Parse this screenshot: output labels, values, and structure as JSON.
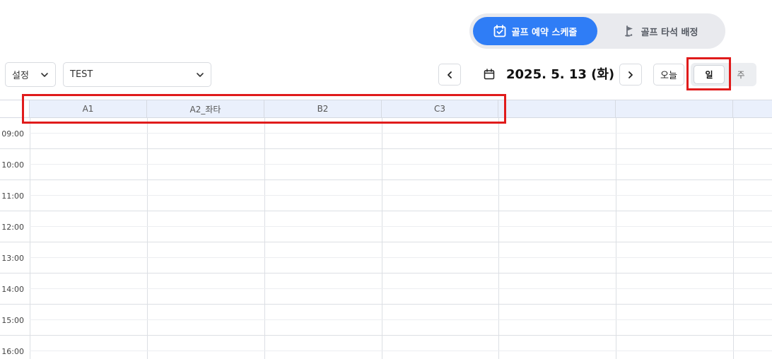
{
  "mode_toggle": {
    "active_label": "골프 예약 스케줄",
    "active_icon": "calendar-check-icon",
    "inactive_label": "골프 타석 배정",
    "inactive_icon": "golf-flag-icon",
    "accent_color": "#2f7df6"
  },
  "toolbar": {
    "settings_select": "설정",
    "store_select": "TEST",
    "date": "2025. 5. 13 (화)",
    "today_label": "오늘",
    "view_day_label": "일",
    "view_week_label": "주",
    "selected_view": "일"
  },
  "schedule": {
    "columns": [
      "A1",
      "A2_좌타",
      "B2",
      "C3",
      "",
      "",
      ""
    ],
    "times": [
      "09:00",
      "10:00",
      "11:00",
      "12:00",
      "13:00",
      "14:00",
      "15:00",
      "16:00"
    ]
  },
  "annotations": {
    "highlight_color": "#e01b1b"
  }
}
